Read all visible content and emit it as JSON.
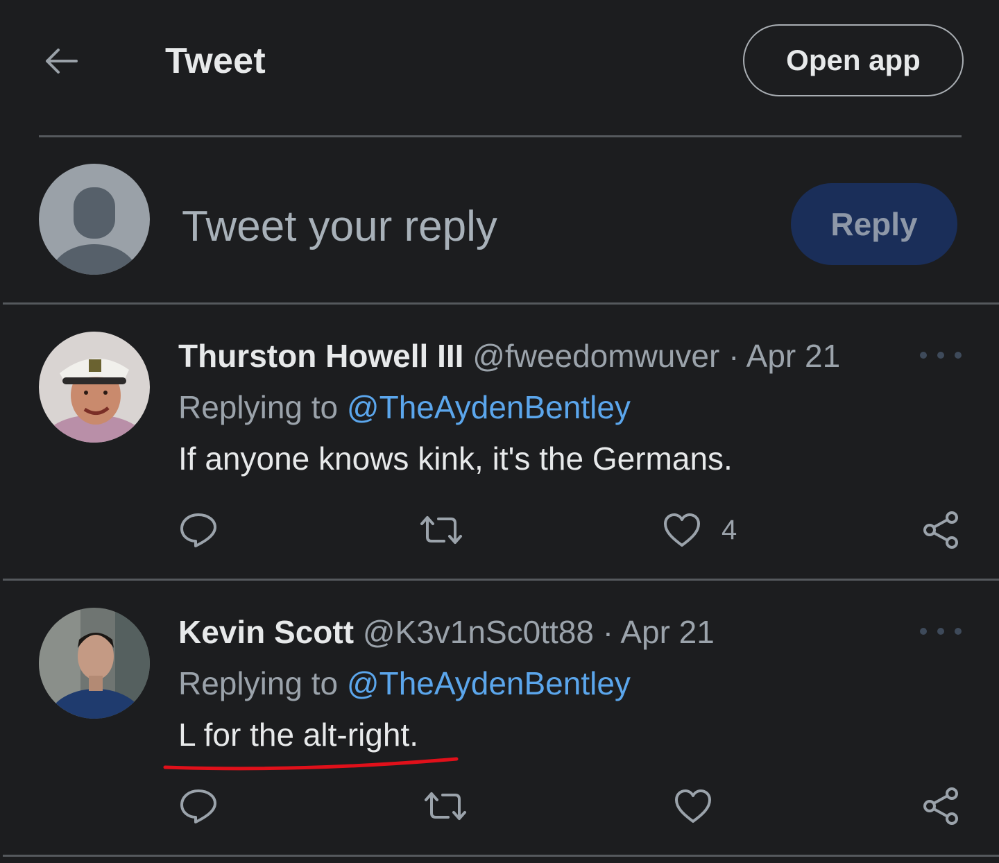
{
  "header": {
    "title": "Tweet",
    "open_app_label": "Open app"
  },
  "compose": {
    "placeholder": "Tweet your reply",
    "reply_label": "Reply"
  },
  "tweets": [
    {
      "name": "Thurston Howell III",
      "handle": "@fweedomwuver",
      "separator": "·",
      "date": "Apr 21",
      "replying_prefix": "Replying to",
      "replying_to": "@TheAydenBentley",
      "text": "If anyone knows kink, it's the Germans.",
      "like_count": "4"
    },
    {
      "name": "Kevin Scott",
      "handle": "@K3v1nSc0tt88",
      "separator": "·",
      "date": "Apr 21",
      "replying_prefix": "Replying to",
      "replying_to": "@TheAydenBentley",
      "text": "L for the alt-right.",
      "like_count": ""
    }
  ],
  "colors": {
    "background": "#1c1d1f",
    "accent_link": "#5ba6ec",
    "reply_button": "#1a2e59",
    "annotation_underline": "#e0101a"
  },
  "icons": [
    "back-arrow-icon",
    "default-avatar-icon",
    "more-icon",
    "reply-icon",
    "retweet-icon",
    "like-icon",
    "share-icon"
  ]
}
